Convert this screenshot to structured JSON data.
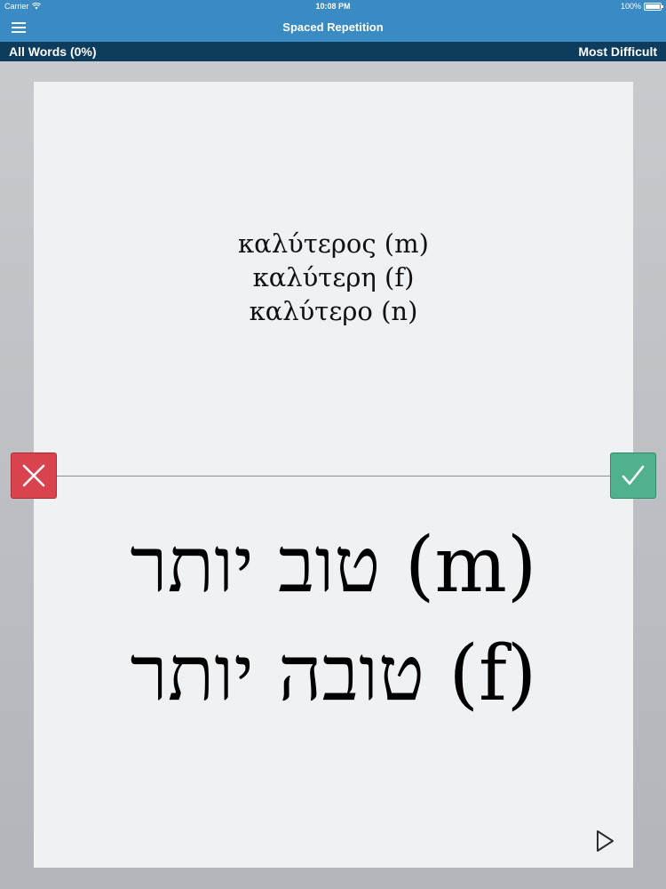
{
  "status_bar": {
    "carrier": "Carrier",
    "time": "10:08 PM",
    "battery": "100%"
  },
  "nav": {
    "title": "Spaced Repetition",
    "menu_icon": "hamburger-menu-icon"
  },
  "sub_bar": {
    "left_label": "All Words (0%)",
    "right_label": "Most Difficult"
  },
  "card": {
    "front_lines": [
      "καλύτερος (m)",
      "καλύτερη (f)",
      "καλύτερο (n)"
    ],
    "back_lines": [
      "טוב יותר (m)",
      "טובה יותר (f)"
    ]
  },
  "controls": {
    "wrong_icon": "x-mark-icon",
    "right_icon": "checkmark-icon",
    "play_icon": "play-icon"
  },
  "colors": {
    "nav_blue": "#3a8ac3",
    "sub_bar_navy": "#0e3c5d",
    "wrong_red": "#d9434d",
    "right_green": "#4fb28c",
    "card_bg": "#eff1f3"
  }
}
